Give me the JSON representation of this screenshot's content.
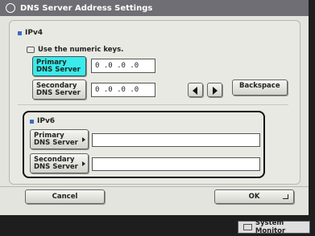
{
  "window": {
    "title": "DNS Server Address Settings"
  },
  "ipv4": {
    "section_label": "IPv4",
    "hint": "Use the numeric keys.",
    "primary": {
      "label_line1": "Primary",
      "label_line2": "DNS Server",
      "value": "0 .0 .0 .0"
    },
    "secondary": {
      "label_line1": "Secondary",
      "label_line2": "DNS Server",
      "value": "0 .0 .0 .0"
    },
    "backspace_label": "Backspace"
  },
  "ipv6": {
    "section_label": "IPv6",
    "primary": {
      "label_line1": "Primary",
      "label_line2": "DNS Server",
      "value": ""
    },
    "secondary": {
      "label_line1": "Secondary",
      "label_line2": "DNS Server",
      "value": ""
    }
  },
  "footer": {
    "cancel_label": "Cancel",
    "ok_label": "OK"
  },
  "status": {
    "system_monitor_label": "System Monitor"
  },
  "colors": {
    "selected_button": "#38ecec",
    "titlebar": "#6e6e74",
    "accent_square": "#3c6cc0"
  }
}
